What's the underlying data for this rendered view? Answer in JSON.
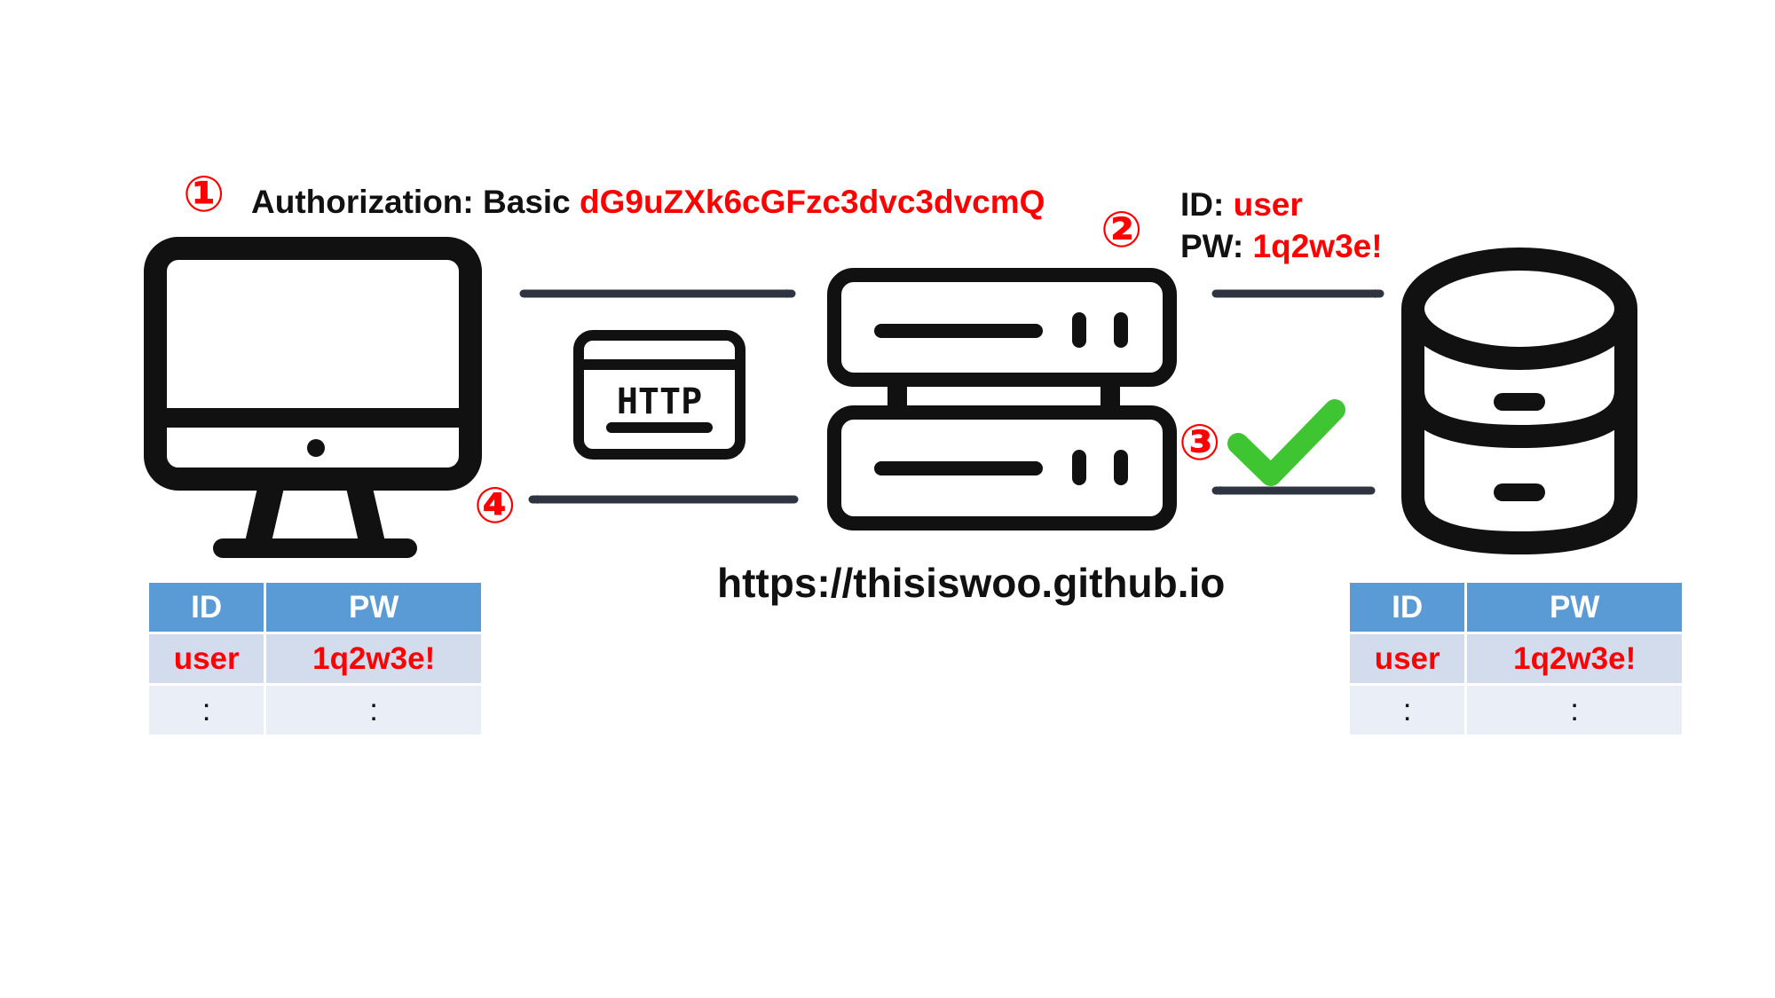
{
  "steps": [
    "①",
    "②",
    "③",
    "④"
  ],
  "request_header": {
    "key": "Authorization:",
    "scheme": "Basic",
    "value": "dG9uZXk6cGFzc3dvc3dvcmQ"
  },
  "credentials": {
    "id_key": "ID:",
    "id_value": "user",
    "pw_key": "PW:",
    "pw_value": "1q2w3e!"
  },
  "http_badge": "HTTP",
  "server_url": "https://thisiswoo.github.io",
  "client_table": {
    "headers": [
      "ID",
      "PW"
    ],
    "rows": [
      [
        "user",
        "1q2w3e!"
      ],
      [
        ":",
        ":"
      ]
    ]
  },
  "db_table": {
    "headers": [
      "ID",
      "PW"
    ],
    "rows": [
      [
        "user",
        "1q2w3e!"
      ],
      [
        ":",
        ":"
      ]
    ]
  },
  "icons": {
    "client": "desktop-monitor-icon",
    "server": "server-rack-icon",
    "database": "database-icon",
    "protocol": "http-window-icon",
    "success": "green-checkmark-icon"
  },
  "colors": {
    "highlight": "#ff0000",
    "arrow": "#2e3440",
    "table_header": "#5b9bd5",
    "table_row1": "#d2dcec",
    "table_row2": "#e9eef7",
    "check": "#3fc532"
  }
}
